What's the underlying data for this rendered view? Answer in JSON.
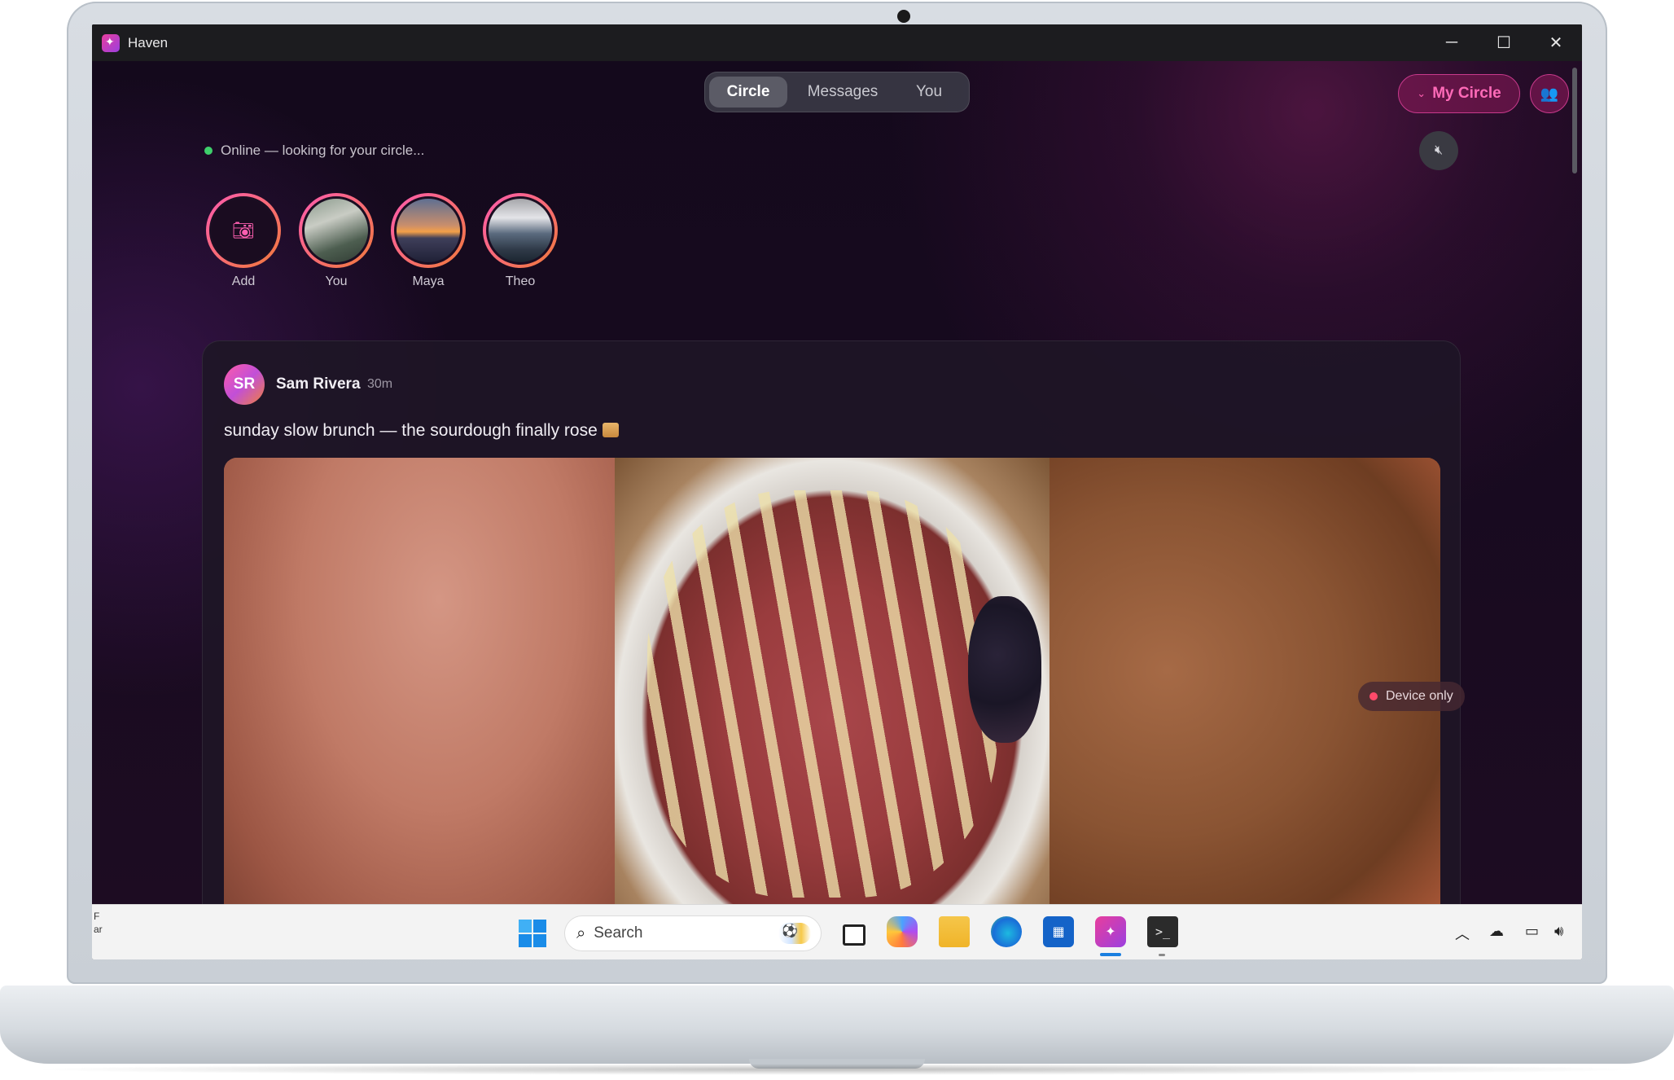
{
  "window": {
    "title": "Haven"
  },
  "nav": {
    "tabs": [
      {
        "label": "Circle",
        "active": true
      },
      {
        "label": "Messages",
        "active": false
      },
      {
        "label": "You",
        "active": false
      }
    ],
    "my_circle_label": "My Circle"
  },
  "status": {
    "text": "Online — looking for your circle..."
  },
  "stories": [
    {
      "name": "Add",
      "icon": "camera-icon"
    },
    {
      "name": "You"
    },
    {
      "name": "Maya"
    },
    {
      "name": "Theo"
    }
  ],
  "post": {
    "avatar_initials": "SR",
    "author": "Sam Rivera",
    "time": "30m",
    "caption": "sunday slow brunch — the sourdough finally rose",
    "visibility_badge": "Device only"
  },
  "taskbar": {
    "search_placeholder": "Search",
    "edge_text": "F\nar"
  },
  "colors": {
    "accent": "#ff5fb0",
    "online": "#3ecf6b",
    "badge_dot": "#ff4a6a"
  }
}
